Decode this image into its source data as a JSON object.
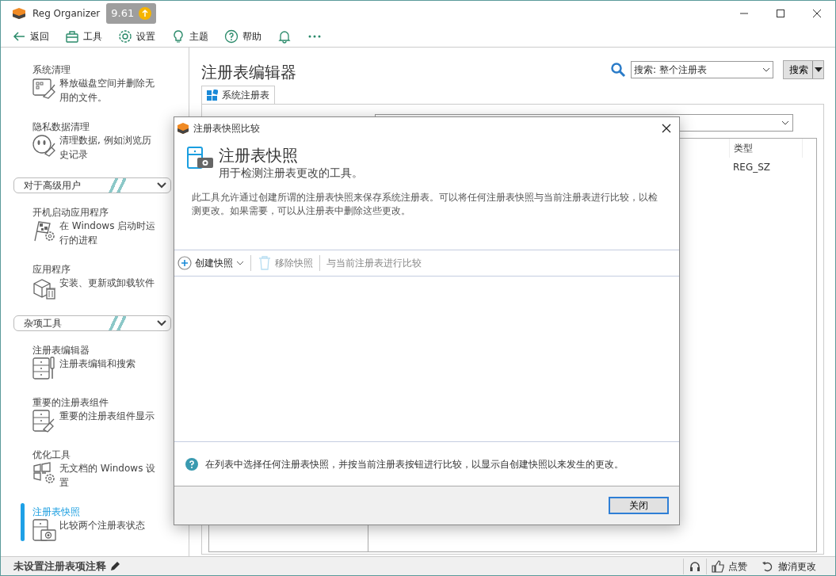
{
  "window": {
    "title": "Reg Organizer",
    "version": "9.61"
  },
  "toolbar": [
    {
      "label": "返回",
      "kind": "back"
    },
    {
      "label": "工具",
      "kind": "tools"
    },
    {
      "label": "设置",
      "kind": "settings"
    },
    {
      "label": "主题",
      "kind": "theme"
    },
    {
      "label": "帮助",
      "kind": "help"
    },
    {
      "kind": "notifications"
    },
    {
      "kind": "more"
    }
  ],
  "sidebar": {
    "items": [
      {
        "kind": "tool",
        "title": "系统清理",
        "description": "释放磁盘空间并删除无用的文件。",
        "selected": false
      },
      {
        "kind": "tool",
        "title": "隐私数据清理",
        "description": "清理数据, 例如浏览历史记录",
        "selected": false
      },
      {
        "kind": "group",
        "label": "对于高级用户",
        "expanded": true
      },
      {
        "kind": "tool",
        "title": "开机启动应用程序",
        "description": "在 Windows 启动时运行的进程",
        "selected": false
      },
      {
        "kind": "tool",
        "title": "应用程序",
        "description": "安装、更新或卸载软件",
        "selected": false
      },
      {
        "kind": "group",
        "label": "杂项工具",
        "expanded": true
      },
      {
        "kind": "tool",
        "title": "注册表编辑器",
        "description": "注册表编辑和搜索",
        "selected": false
      },
      {
        "kind": "tool",
        "title": "重要的注册表组件",
        "description": "重要的注册表组件显示",
        "selected": false
      },
      {
        "kind": "tool",
        "title": "优化工具",
        "description": "无文档的 Windows 设置",
        "selected": false
      },
      {
        "kind": "tool",
        "title": "注册表快照",
        "description": "比较两个注册表状态",
        "selected": true
      }
    ]
  },
  "main": {
    "title": "注册表编辑器",
    "search": {
      "value": "搜索: 整个注册表"
    },
    "search_button": "搜索",
    "tabs": [
      {
        "label": "系统注册表",
        "selected": true
      }
    ],
    "table": {
      "columns": [
        "类型"
      ],
      "rows": [
        [
          "REG_SZ"
        ]
      ]
    }
  },
  "dialog": {
    "title": "注册表快照比较",
    "heading": "注册表快照",
    "subtitle": "用于检测注册表更改的工具。",
    "description": "此工具允许通过创建所谓的注册表快照来保存系统注册表。可以将任何注册表快照与当前注册表进行比较，以检测更改。如果需要，可以从注册表中删除这些更改。",
    "actions": [
      {
        "kind": "create",
        "label": "创建快照",
        "disabled": false
      },
      {
        "kind": "remove",
        "label": "移除快照",
        "disabled": true
      },
      {
        "kind": "compare",
        "label": "与当前注册表进行比较",
        "disabled": true
      }
    ],
    "hint": "在列表中选择任何注册表快照，并按当前注册表按钮进行比较，以显示自创建快照以来发生的更改。",
    "close_button": "关闭"
  },
  "status_bar": {
    "note": "未设置注册表项注释",
    "like": "点赞",
    "undo": "撤消更改"
  }
}
